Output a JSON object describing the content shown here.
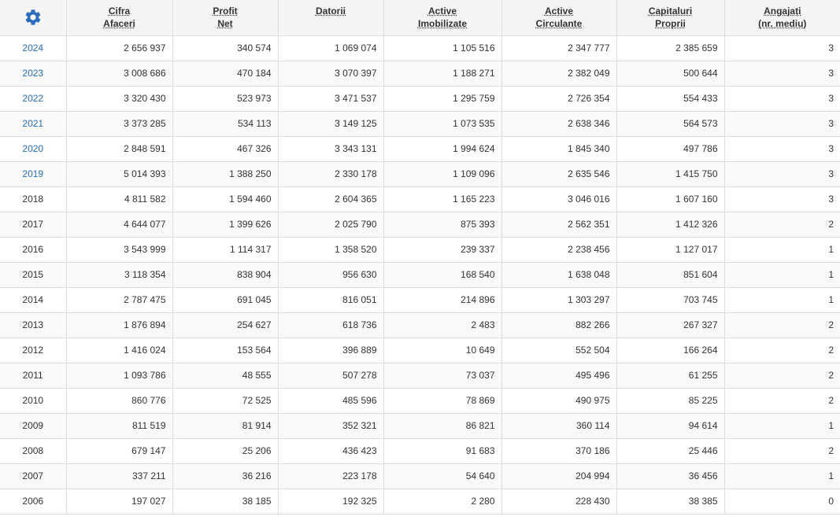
{
  "header": {
    "settings_icon": "gear-icon",
    "columns": [
      {
        "line1": "Cifra",
        "line2": "Afaceri"
      },
      {
        "line1": "Profit",
        "line2": "Net"
      },
      {
        "line1": "Datorii",
        "line2": ""
      },
      {
        "line1": "Active",
        "line2": "Imobilizate"
      },
      {
        "line1": "Active",
        "line2": "Circulante"
      },
      {
        "line1": "Capitaluri",
        "line2": "Proprii"
      },
      {
        "line1": "Angajați",
        "line2": "(nr. mediu)"
      }
    ]
  },
  "colors": {
    "accent": "#2a6ebb",
    "header_bg": "#f5f5f5",
    "border": "#dddddd"
  },
  "rows": [
    {
      "year": "2024",
      "link": true,
      "values": [
        "2 656 937",
        "340 574",
        "1 069 074",
        "1 105 516",
        "2 347 777",
        "2 385 659",
        "3"
      ]
    },
    {
      "year": "2023",
      "link": true,
      "values": [
        "3 008 686",
        "470 184",
        "3 070 397",
        "1 188 271",
        "2 382 049",
        "500 644",
        "3"
      ]
    },
    {
      "year": "2022",
      "link": true,
      "values": [
        "3 320 430",
        "523 973",
        "3 471 537",
        "1 295 759",
        "2 726 354",
        "554 433",
        "3"
      ]
    },
    {
      "year": "2021",
      "link": true,
      "values": [
        "3 373 285",
        "534 113",
        "3 149 125",
        "1 073 535",
        "2 638 346",
        "564 573",
        "3"
      ]
    },
    {
      "year": "2020",
      "link": true,
      "values": [
        "2 848 591",
        "467 326",
        "3 343 131",
        "1 994 624",
        "1 845 340",
        "497 786",
        "3"
      ]
    },
    {
      "year": "2019",
      "link": true,
      "values": [
        "5 014 393",
        "1 388 250",
        "2 330 178",
        "1 109 096",
        "2 635 546",
        "1 415 750",
        "3"
      ]
    },
    {
      "year": "2018",
      "link": false,
      "values": [
        "4 811 582",
        "1 594 460",
        "2 604 365",
        "1 165 223",
        "3 046 016",
        "1 607 160",
        "3"
      ]
    },
    {
      "year": "2017",
      "link": false,
      "values": [
        "4 644 077",
        "1 399 626",
        "2 025 790",
        "875 393",
        "2 562 351",
        "1 412 326",
        "2"
      ]
    },
    {
      "year": "2016",
      "link": false,
      "values": [
        "3 543 999",
        "1 114 317",
        "1 358 520",
        "239 337",
        "2 238 456",
        "1 127 017",
        "1"
      ]
    },
    {
      "year": "2015",
      "link": false,
      "values": [
        "3 118 354",
        "838 904",
        "956 630",
        "168 540",
        "1 638 048",
        "851 604",
        "1"
      ]
    },
    {
      "year": "2014",
      "link": false,
      "values": [
        "2 787 475",
        "691 045",
        "816 051",
        "214 896",
        "1 303 297",
        "703 745",
        "1"
      ]
    },
    {
      "year": "2013",
      "link": false,
      "values": [
        "1 876 894",
        "254 627",
        "618 736",
        "2 483",
        "882 266",
        "267 327",
        "2"
      ]
    },
    {
      "year": "2012",
      "link": false,
      "values": [
        "1 416 024",
        "153 564",
        "396 889",
        "10 649",
        "552 504",
        "166 264",
        "2"
      ]
    },
    {
      "year": "2011",
      "link": false,
      "values": [
        "1 093 786",
        "48 555",
        "507 278",
        "73 037",
        "495 496",
        "61 255",
        "2"
      ]
    },
    {
      "year": "2010",
      "link": false,
      "values": [
        "860 776",
        "72 525",
        "485 596",
        "78 869",
        "490 975",
        "85 225",
        "2"
      ]
    },
    {
      "year": "2009",
      "link": false,
      "values": [
        "811 519",
        "81 914",
        "352 321",
        "86 821",
        "360 114",
        "94 614",
        "1"
      ]
    },
    {
      "year": "2008",
      "link": false,
      "values": [
        "679 147",
        "25 206",
        "436 423",
        "91 683",
        "370 186",
        "25 446",
        "2"
      ]
    },
    {
      "year": "2007",
      "link": false,
      "values": [
        "337 211",
        "36 216",
        "223 178",
        "54 640",
        "204 994",
        "36 456",
        "1"
      ]
    },
    {
      "year": "2006",
      "link": false,
      "values": [
        "197 027",
        "38 185",
        "192 325",
        "2 280",
        "228 430",
        "38 385",
        "0"
      ]
    }
  ]
}
